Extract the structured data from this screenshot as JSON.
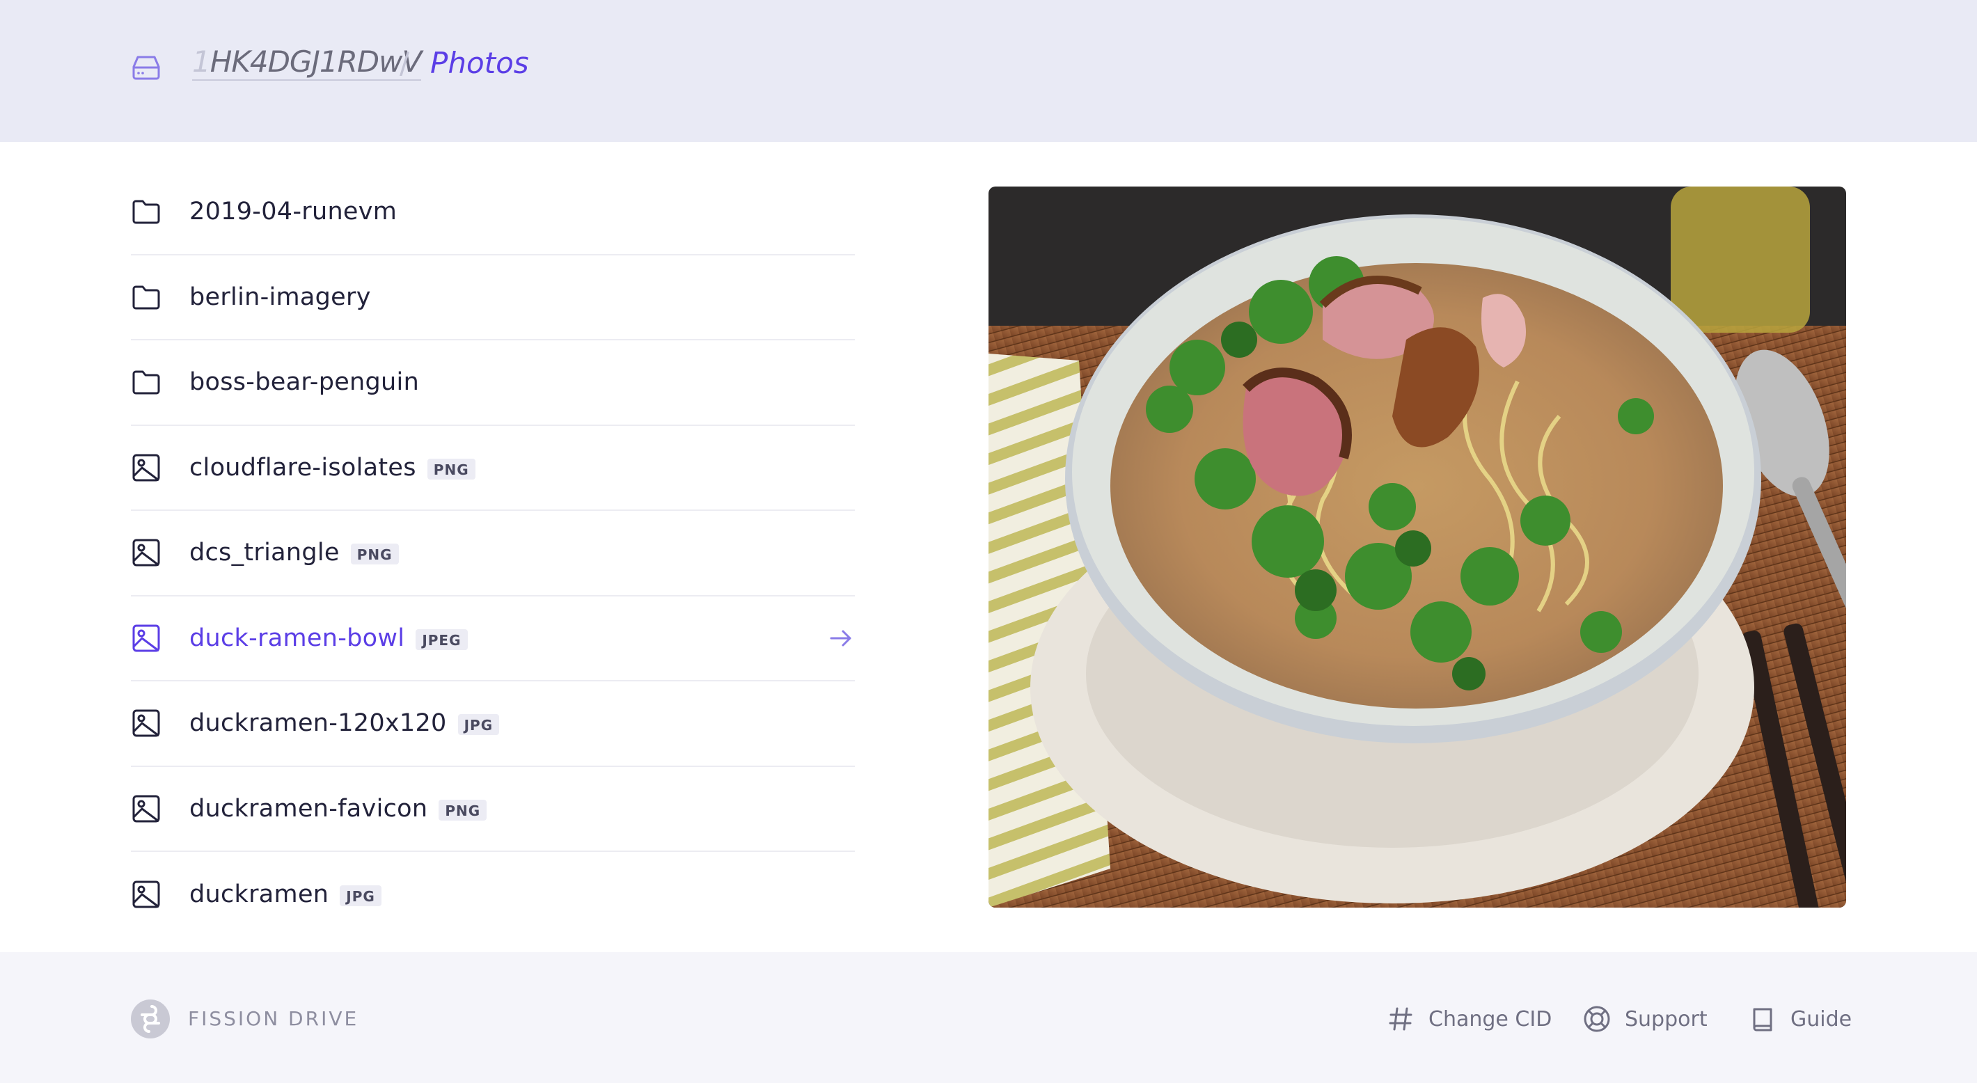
{
  "header": {
    "cid_faded": "1",
    "cid_main": "HK4DGJ1RDwV",
    "separator": "/",
    "current": "Photos"
  },
  "files": [
    {
      "name": "2019-04-runevm",
      "type": "folder",
      "ext": ""
    },
    {
      "name": "berlin-imagery",
      "type": "folder",
      "ext": ""
    },
    {
      "name": "boss-bear-penguin",
      "type": "folder",
      "ext": ""
    },
    {
      "name": "cloudflare-isolates",
      "type": "image",
      "ext": "PNG"
    },
    {
      "name": "dcs_triangle",
      "type": "image",
      "ext": "PNG"
    },
    {
      "name": "duck-ramen-bowl",
      "type": "image",
      "ext": "JPEG",
      "active": true
    },
    {
      "name": "duckramen-120x120",
      "type": "image",
      "ext": "JPG"
    },
    {
      "name": "duckramen-favicon",
      "type": "image",
      "ext": "PNG"
    },
    {
      "name": "duckramen",
      "type": "image",
      "ext": "JPG"
    }
  ],
  "preview": {
    "icon": "photo-of-duck-ramen-bowl"
  },
  "footer": {
    "brand": "FISSION DRIVE",
    "links": {
      "change_cid": "Change CID",
      "support": "Support",
      "guide": "Guide"
    }
  },
  "colors": {
    "accent": "#5b3ee6",
    "header_bg": "#e9eaf5",
    "footer_bg": "#f5f5fa"
  }
}
